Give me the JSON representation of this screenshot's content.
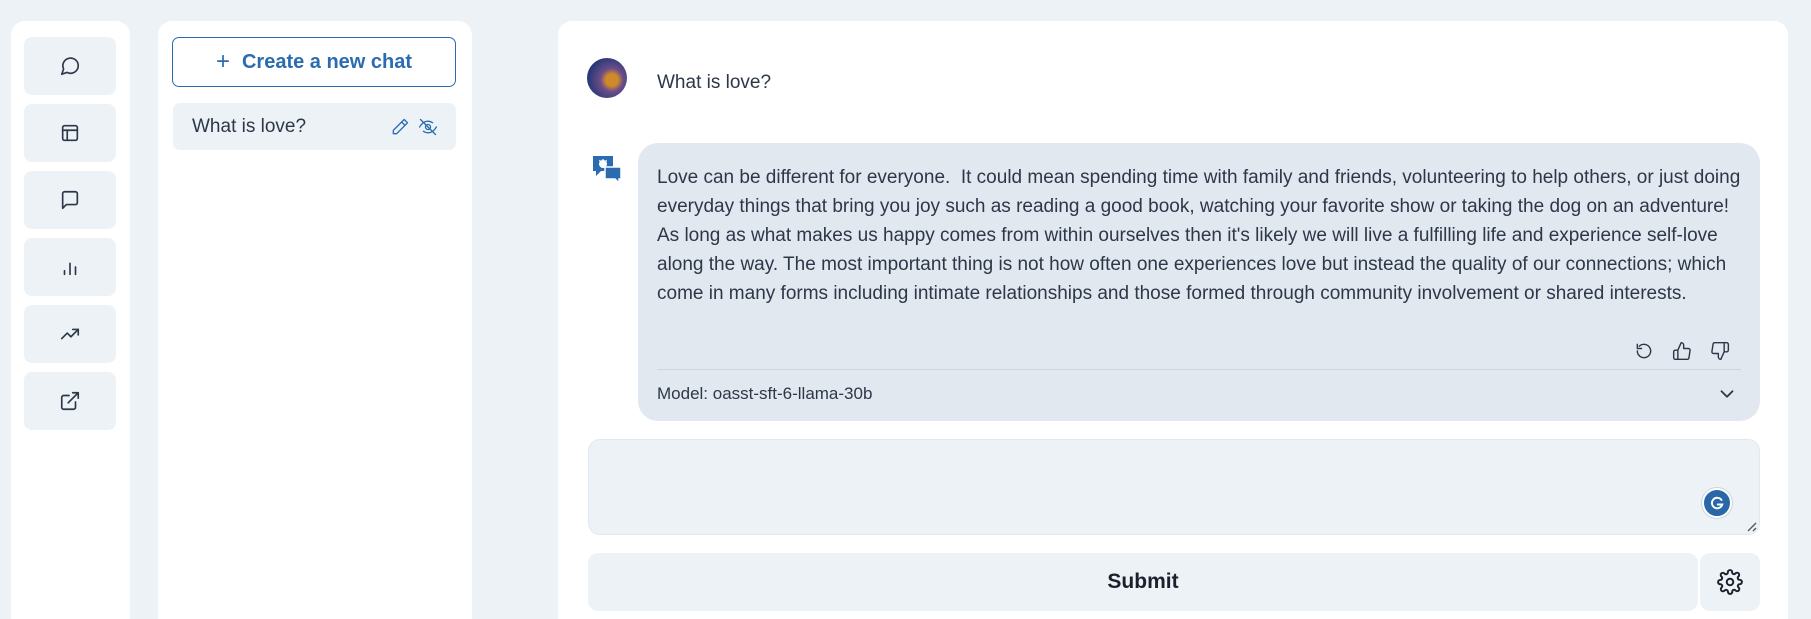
{
  "nav": {
    "items": [
      {
        "icon": "chat-bubble-round-icon"
      },
      {
        "icon": "layout-icon"
      },
      {
        "icon": "message-square-icon"
      },
      {
        "icon": "bar-chart-icon"
      },
      {
        "icon": "trending-up-icon"
      },
      {
        "icon": "external-link-icon"
      }
    ]
  },
  "sidebar": {
    "new_chat_label": "Create a new chat",
    "chats": [
      {
        "title": "What is love?"
      }
    ]
  },
  "conversation": {
    "user_message": "What is love?",
    "assistant_message": "Love can be different for everyone.  It could mean spending time with family and friends, volunteering to help others, or just doing everyday things that bring you joy such as reading a good book, watching your favorite show or taking the dog on an adventure! As long as what makes us happy comes from within ourselves then it's likely we will live a fulfilling life and experience self-love along the way. The most important thing is not how often one experiences love but instead the quality of our connections; which come in many forms including intimate relationships and those formed through community involvement or shared interests.",
    "model_label": "Model: oasst-sft-6-llama-30b"
  },
  "composer": {
    "input_value": "",
    "submit_label": "Submit"
  },
  "colors": {
    "accent": "#2b6cb0",
    "background": "#edf2f7",
    "bubble": "#e2e8f0"
  }
}
